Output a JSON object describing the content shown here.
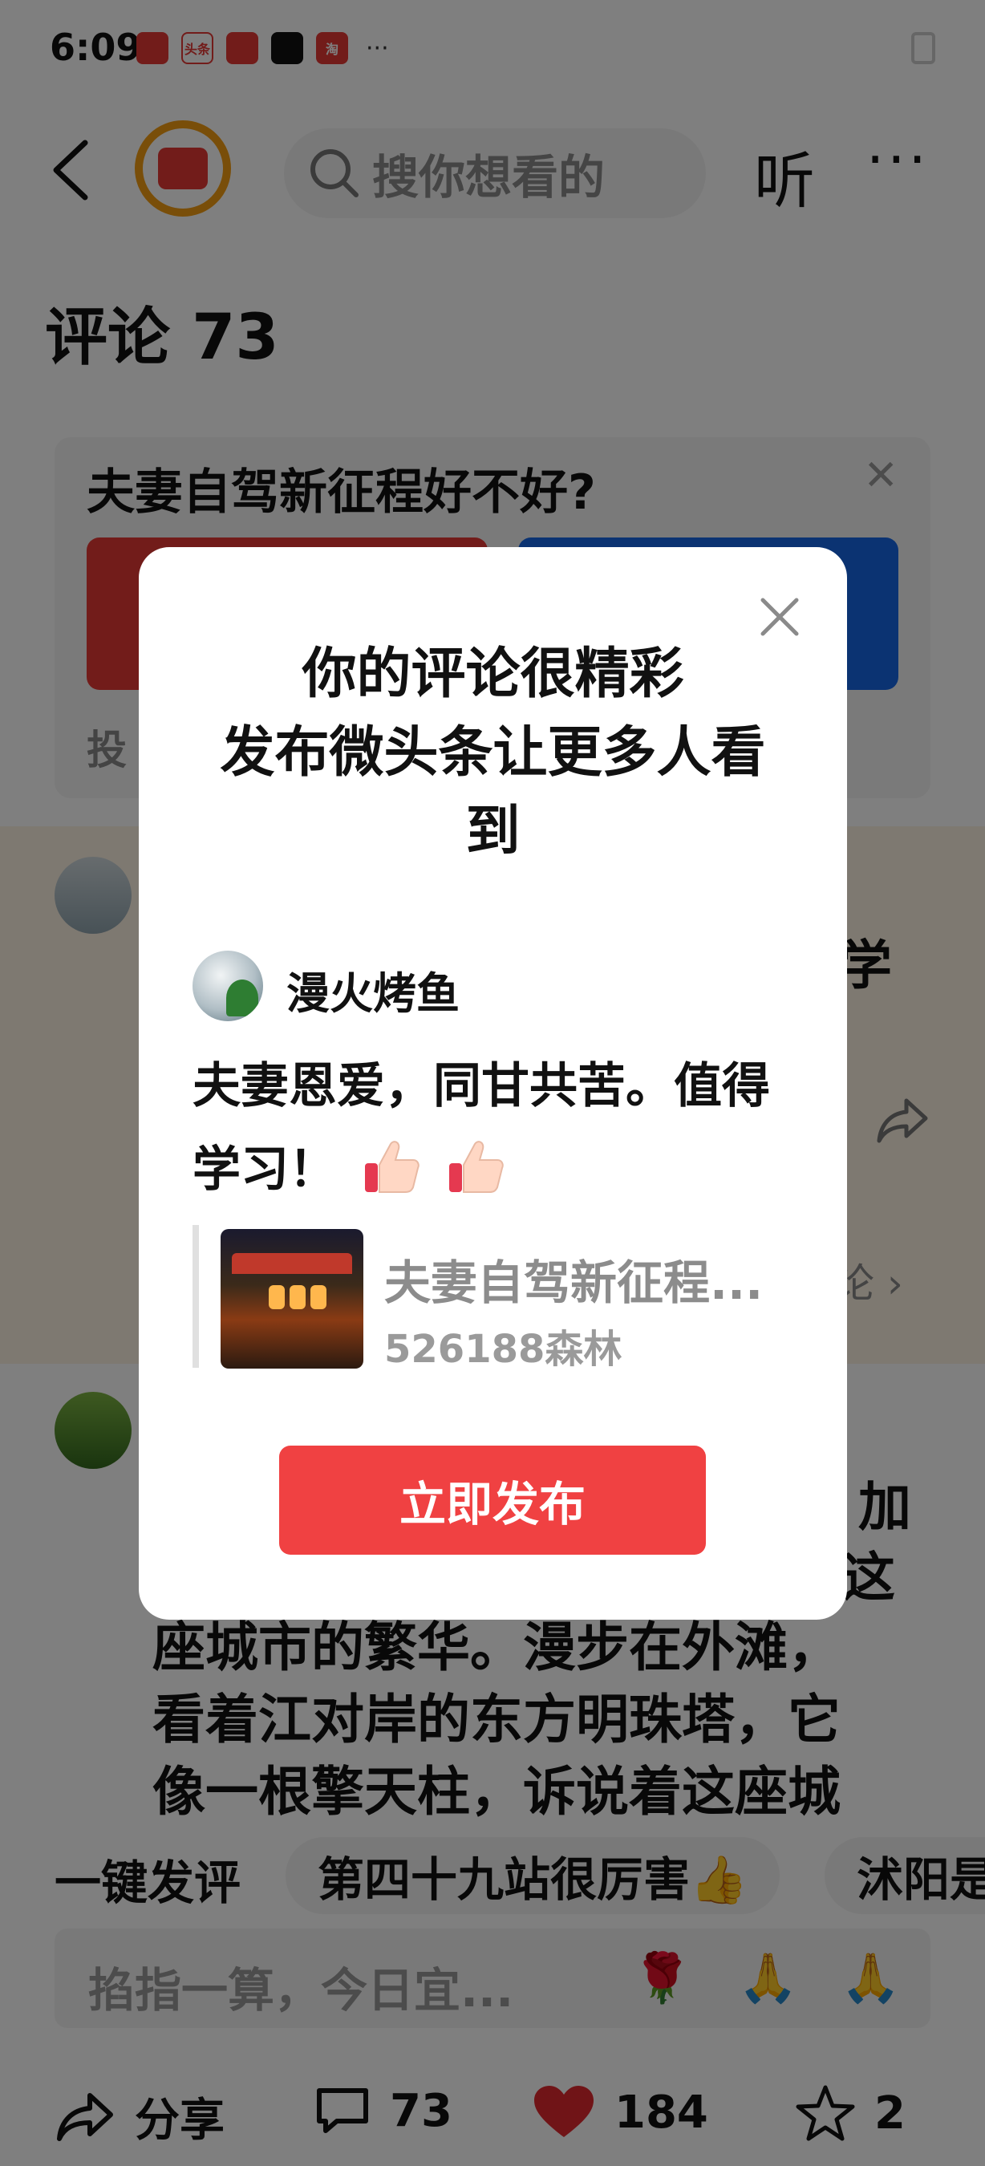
{
  "status_bar": {
    "time": "6:09",
    "app_icons": [
      "huawei-app",
      "toutiao-app",
      "red-book-app",
      "qq-app",
      "taobao-app"
    ],
    "toutiao_label": "头条",
    "taobao_label": "淘",
    "more": "···"
  },
  "top_bar": {
    "search_placeholder": "搜你想看的",
    "listen_label": "听",
    "more_label": "···"
  },
  "comments": {
    "title": "评论 73"
  },
  "poll": {
    "question": "夫妻自驾新征程好不好?",
    "hint": "投"
  },
  "comment_list": {
    "first_tail": "学",
    "first_quote_tail": "论 ›",
    "second_lines": [
      "加",
      "这",
      "座城市的繁华。漫步在外滩，",
      "看着江对岸的东方明珠塔，它",
      "像一根擎天柱，诉说着这座城"
    ]
  },
  "quick_reply": {
    "label": "一键发评",
    "chips": [
      "第四十九站很厉害👍",
      "沭阳是"
    ]
  },
  "input_bar": {
    "placeholder": "掐指一算，今日宜...",
    "emojis": [
      "🌹",
      "🙏",
      "🙏"
    ]
  },
  "bottom_bar": {
    "share_label": "分享",
    "comment_count": "73",
    "like_count": "184",
    "favorite_count": "2"
  },
  "modal": {
    "title_line1": "你的评论很精彩",
    "title_line2": "发布微头条让更多人看",
    "title_line3": "到",
    "username": "漫火烤鱼",
    "comment_text": "夫妻恩爱，同甘共苦。值得学习！",
    "quote_title": "夫妻自驾新征程...",
    "quote_author": "526188森林",
    "publish_label": "立即发布"
  },
  "colors": {
    "accent_red": "#f04142",
    "poll_blue": "#1766e5",
    "overlay": "rgba(0,0,0,0.5)"
  }
}
